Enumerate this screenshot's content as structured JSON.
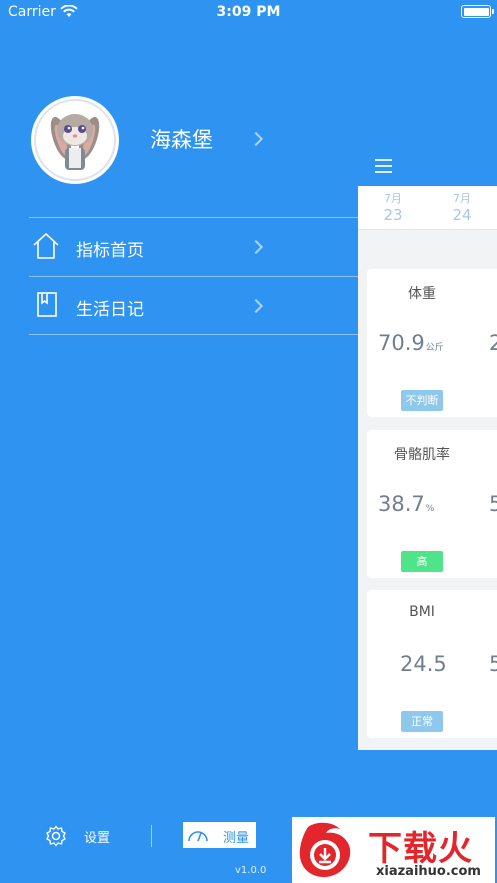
{
  "status_bar": {
    "carrier": "Carrier",
    "time": "3:09 PM"
  },
  "profile": {
    "name": "海森堡"
  },
  "menu": [
    {
      "label": "指标首页",
      "icon": "home-icon"
    },
    {
      "label": "生活日记",
      "icon": "diary-book-icon"
    }
  ],
  "dates": [
    {
      "month": "7月",
      "day": "23"
    },
    {
      "month": "7月",
      "day": "24"
    }
  ],
  "cards": [
    {
      "title": "体重",
      "value": "70.9",
      "unit": "公斤",
      "peek": "2",
      "badge": "不判断",
      "badge_color": "#8EC8EC"
    },
    {
      "title": "骨骼肌率",
      "value": "38.7",
      "unit": "%",
      "peek": "5",
      "badge": "高",
      "badge_color": "#4FE38A"
    },
    {
      "title": "BMI",
      "value": "24.5",
      "unit": "",
      "peek": "5",
      "badge": "正常",
      "badge_color": "#8EC8EC"
    }
  ],
  "bottom": {
    "settings_label": "设置",
    "measure_label": "测量",
    "version": "v1.0.0"
  },
  "watermark": {
    "main": "下载火",
    "sub": "xiazaihuo.com"
  },
  "colors": {
    "background": "#2F93F1",
    "accent_text": "#6F7F8F"
  }
}
